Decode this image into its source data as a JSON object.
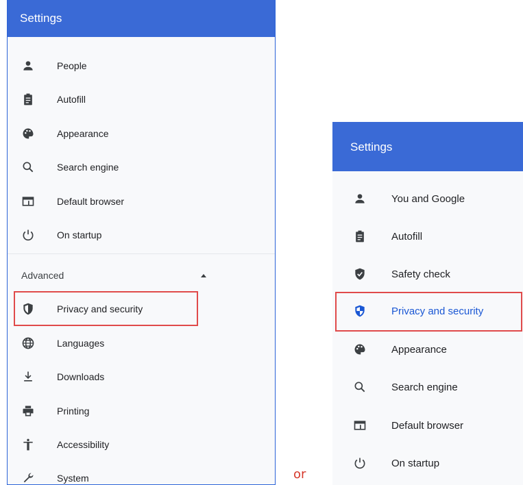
{
  "left_panel": {
    "header": "Settings",
    "items": [
      {
        "label": "People",
        "icon": "person-icon"
      },
      {
        "label": "Autofill",
        "icon": "clipboard-icon"
      },
      {
        "label": "Appearance",
        "icon": "palette-icon"
      },
      {
        "label": "Search engine",
        "icon": "search-icon"
      },
      {
        "label": "Default browser",
        "icon": "browser-icon"
      },
      {
        "label": "On startup",
        "icon": "power-icon"
      }
    ],
    "advanced_label": "Advanced",
    "advanced_items": [
      {
        "label": "Privacy and security",
        "icon": "shield-icon"
      },
      {
        "label": "Languages",
        "icon": "globe-icon"
      },
      {
        "label": "Downloads",
        "icon": "download-icon"
      },
      {
        "label": "Printing",
        "icon": "printer-icon"
      },
      {
        "label": "Accessibility",
        "icon": "accessibility-icon"
      },
      {
        "label": "System",
        "icon": "wrench-icon"
      }
    ]
  },
  "separator": "or",
  "right_panel": {
    "header": "Settings",
    "items": [
      {
        "label": "You and Google",
        "icon": "person-icon"
      },
      {
        "label": "Autofill",
        "icon": "clipboard-icon"
      },
      {
        "label": "Safety check",
        "icon": "shield-check-icon"
      },
      {
        "label": "Privacy and security",
        "icon": "shield-icon"
      },
      {
        "label": "Appearance",
        "icon": "palette-icon"
      },
      {
        "label": "Search engine",
        "icon": "search-icon"
      },
      {
        "label": "Default browser",
        "icon": "browser-icon"
      },
      {
        "label": "On startup",
        "icon": "power-icon"
      }
    ]
  },
  "colors": {
    "header_blue": "#3a6ad6",
    "highlight_red": "#e04a4a",
    "active_blue": "#1a57d4"
  }
}
